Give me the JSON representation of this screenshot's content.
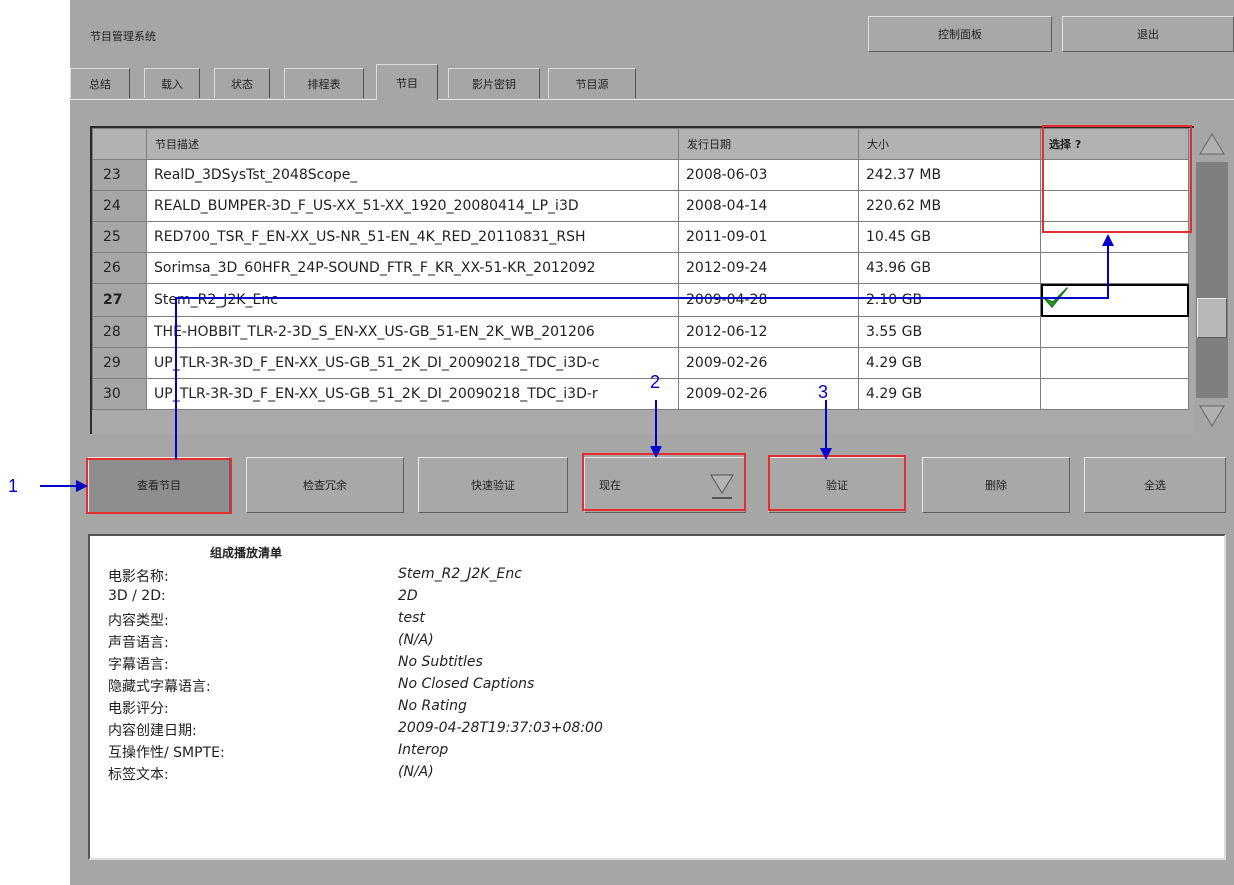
{
  "app": {
    "title": "节目管理系统"
  },
  "top_buttons": {
    "control_panel": "控制面板",
    "exit": "退出"
  },
  "tabs": [
    {
      "label": "总结"
    },
    {
      "label": "载入"
    },
    {
      "label": "状态"
    },
    {
      "label": "排程表"
    },
    {
      "label": "节目"
    },
    {
      "label": "影片密钥"
    },
    {
      "label": "节目源"
    }
  ],
  "table": {
    "headers": {
      "description": "节目描述",
      "release_date": "发行日期",
      "size": "大小",
      "select": "选择 ?"
    },
    "rows": [
      {
        "num": "23",
        "desc": "RealD_3DSysTst_2048Scope_",
        "date": "2008-06-03",
        "size": "242.37 MB"
      },
      {
        "num": "24",
        "desc": "REALD_BUMPER-3D_F_US-XX_51-XX_1920_20080414_LP_i3D",
        "date": "2008-04-14",
        "size": "220.62 MB"
      },
      {
        "num": "25",
        "desc": "RED700_TSR_F_EN-XX_US-NR_51-EN_4K_RED_20110831_RSH",
        "date": "2011-09-01",
        "size": "10.45 GB"
      },
      {
        "num": "26",
        "desc": "Sorimsa_3D_60HFR_24P-SOUND_FTR_F_KR_XX-51-KR_2012092",
        "date": "2012-09-24",
        "size": "43.96 GB"
      },
      {
        "num": "27",
        "desc": "Stem_R2_J2K_Enc",
        "date": "2009-04-28",
        "size": "2.10 GB"
      },
      {
        "num": "28",
        "desc": "THE-HOBBIT_TLR-2-3D_S_EN-XX_US-GB_51-EN_2K_WB_201206",
        "date": "2012-06-12",
        "size": "3.55 GB"
      },
      {
        "num": "29",
        "desc": "UP_TLR-3R-3D_F_EN-XX_US-GB_51_2K_DI_20090218_TDC_i3D-c",
        "date": "2009-02-26",
        "size": "4.29 GB"
      },
      {
        "num": "30",
        "desc": "UP_TLR-3R-3D_F_EN-XX_US-GB_51_2K_DI_20090218_TDC_i3D-r",
        "date": "2009-02-26",
        "size": "4.29 GB"
      }
    ],
    "selected_row": "27"
  },
  "buttons": {
    "view_show": "查看节目",
    "check_redundancy": "检查冗余",
    "quick_verify": "快速验证",
    "time_select": "现在",
    "verify": "验证",
    "delete": "删除",
    "select_all": "全选"
  },
  "details": {
    "title": "组成播放清单",
    "fields": [
      {
        "label": "电影名称:",
        "value": "Stem_R2_J2K_Enc"
      },
      {
        "label": "3D / 2D:",
        "value": "2D"
      },
      {
        "label": "内容类型:",
        "value": "test"
      },
      {
        "label": "声音语言:",
        "value": "(N/A)"
      },
      {
        "label": "字幕语言:",
        "value": "No Subtitles"
      },
      {
        "label": "隐藏式字幕语言:",
        "value": "No Closed Captions"
      },
      {
        "label": "电影评分:",
        "value": "No Rating"
      },
      {
        "label": "内容创建日期:",
        "value": "2009-04-28T19:37:03+08:00"
      },
      {
        "label": "互操作性/ SMPTE:",
        "value": "Interop"
      },
      {
        "label": "标签文本:",
        "value": "(N/A)"
      }
    ]
  },
  "callouts": {
    "c1": "1",
    "c2": "2",
    "c3": "3"
  },
  "colors": {
    "accent_red": "#e62d2d",
    "arrow_blue": "#0000cc",
    "check_green": "#2e9e2e"
  }
}
